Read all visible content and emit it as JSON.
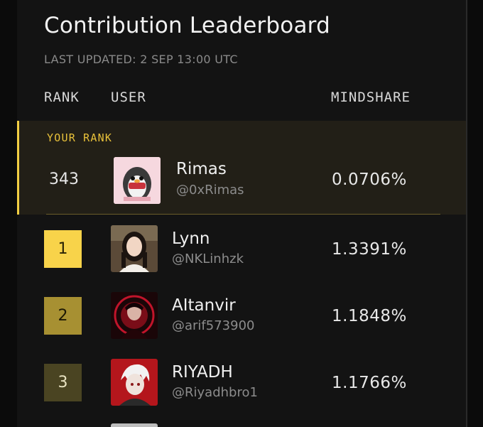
{
  "header": {
    "title": "Contribution Leaderboard",
    "last_updated": "LAST UPDATED: 2 SEP 13:00 UTC"
  },
  "columns": {
    "rank": "RANK",
    "user": "USER",
    "mindshare": "MINDSHARE"
  },
  "your_rank": {
    "label": "YOUR RANK",
    "rank": "343",
    "name": "Rimas",
    "handle": "@0xRimas",
    "mindshare": "0.0706%",
    "avatar_icon": "penguin-avatar-icon"
  },
  "leaders": [
    {
      "rank": "1",
      "name": "Lynn",
      "handle": "@NKLinhzk",
      "mindshare": "1.3391%",
      "avatar_icon": "portrait-avatar-icon",
      "badge_color": "#f8d34a"
    },
    {
      "rank": "2",
      "name": "AItanvir",
      "handle": "@arif573900",
      "mindshare": "1.1848%",
      "avatar_icon": "anime-avatar-icon",
      "badge_color": "#a79032"
    },
    {
      "rank": "3",
      "name": "RIYADH",
      "handle": "@Riyadhbro1",
      "mindshare": "1.1766%",
      "avatar_icon": "anime-avatar-icon",
      "badge_color": "#4a4422"
    }
  ],
  "colors": {
    "accent": "#f3cf43",
    "background": "#131313",
    "highlight_row": "#221f17"
  }
}
